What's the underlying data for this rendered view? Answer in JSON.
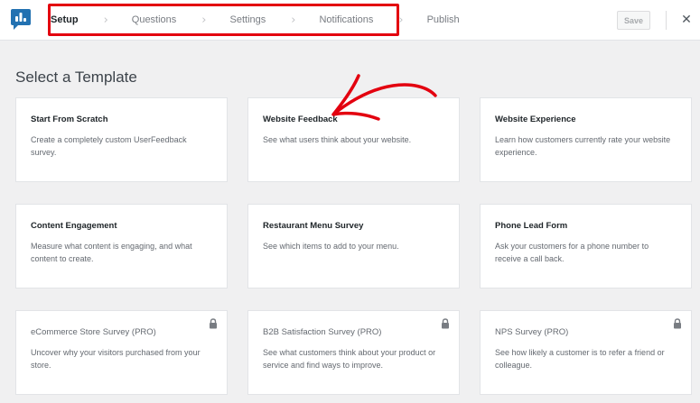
{
  "header": {
    "steps": [
      "Setup",
      "Questions",
      "Settings",
      "Notifications",
      "Publish"
    ],
    "active_step": "Setup",
    "save_label": "Save",
    "close_glyph": "✕"
  },
  "main": {
    "title": "Select a Template",
    "templates": [
      {
        "title": "Start From Scratch",
        "description": "Create a completely custom UserFeedback survey.",
        "pro": false
      },
      {
        "title": "Website Feedback",
        "description": "See what users think about your website.",
        "pro": false
      },
      {
        "title": "Website Experience",
        "description": "Learn how customers currently rate your website experience.",
        "pro": false
      },
      {
        "title": "Content Engagement",
        "description": "Measure what content is engaging, and what content to create.",
        "pro": false
      },
      {
        "title": "Restaurant Menu Survey",
        "description": "See which items to add to your menu.",
        "pro": false
      },
      {
        "title": "Phone Lead Form",
        "description": "Ask your customers for a phone number to receive a call back.",
        "pro": false
      },
      {
        "title": "eCommerce Store Survey (PRO)",
        "description": "Uncover why your visitors purchased from your store.",
        "pro": true
      },
      {
        "title": "B2B Satisfaction Survey (PRO)",
        "description": "See what customers think about your product or service and find ways to improve.",
        "pro": true
      },
      {
        "title": "NPS Survey (PRO)",
        "description": "See how likely a customer is to refer a friend or colleague.",
        "pro": true
      }
    ]
  },
  "colors": {
    "brand": "#2271b1",
    "highlight": "#e3000f",
    "background": "#f0f0f1"
  },
  "icons": {
    "logo": "userfeedback-logo-icon",
    "lock": "lock-icon",
    "arrow": "annotation-arrow-icon"
  }
}
